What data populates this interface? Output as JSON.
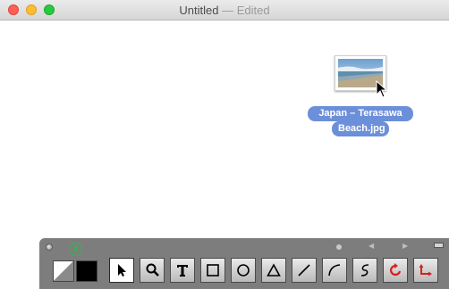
{
  "window": {
    "title": "Untitled",
    "separator": "—",
    "status": "Edited"
  },
  "file": {
    "name_line1": "Japan – Terasawa",
    "name_line2": "Beach.jpg",
    "icon": "image-thumbnail-icon"
  },
  "palette": {
    "colors": {
      "stroke": "#000000",
      "fill": "#ffffff",
      "accent_green": "#2fb84a",
      "label_bg": "#6c8fd9"
    },
    "tools": [
      {
        "name": "select-tool",
        "icon": "arrow-cursor-icon",
        "selected": true
      },
      {
        "name": "zoom-tool",
        "icon": "magnifier-icon",
        "selected": false
      },
      {
        "name": "text-tool",
        "icon": "text-t-icon",
        "selected": false
      },
      {
        "name": "rectangle-tool",
        "icon": "square-icon",
        "selected": false
      },
      {
        "name": "oval-tool",
        "icon": "circle-icon",
        "selected": false
      },
      {
        "name": "polygon-tool",
        "icon": "triangle-icon",
        "selected": false
      },
      {
        "name": "line-tool",
        "icon": "line-icon",
        "selected": false
      },
      {
        "name": "arc-tool",
        "icon": "arc-icon",
        "selected": false
      },
      {
        "name": "freehand-tool",
        "icon": "squiggle-icon",
        "selected": false
      },
      {
        "name": "rotate-tool",
        "icon": "rotate-icon",
        "selected": false
      },
      {
        "name": "connector-tool",
        "icon": "elbow-arrow-icon",
        "selected": false
      }
    ]
  }
}
